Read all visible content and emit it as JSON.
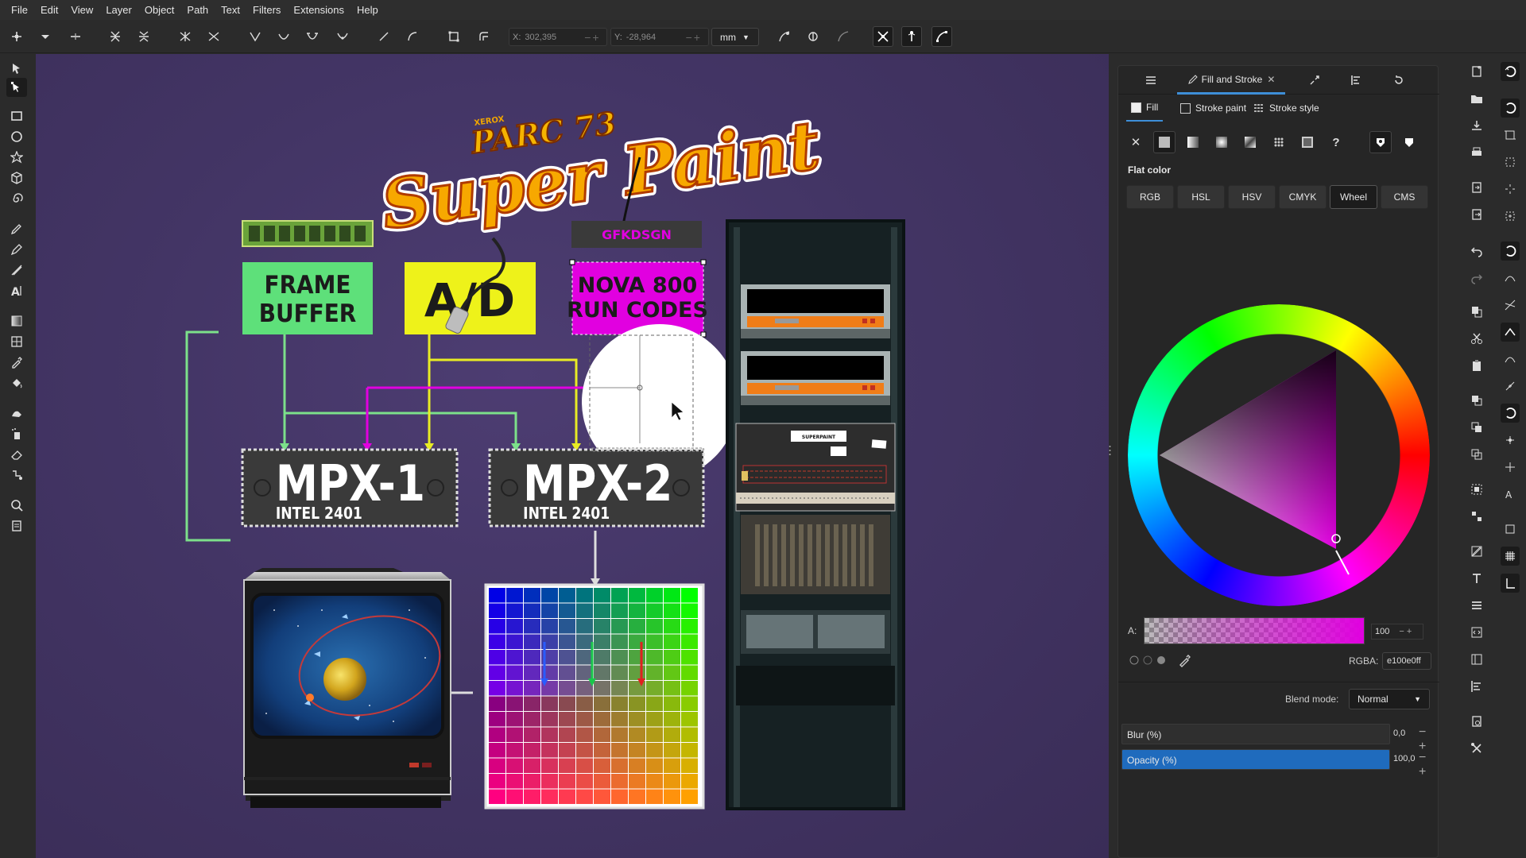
{
  "menu": [
    "File",
    "Edit",
    "View",
    "Layer",
    "Object",
    "Path",
    "Text",
    "Filters",
    "Extensions",
    "Help"
  ],
  "toolbar": {
    "x_label": "X:",
    "x_value": "302,395",
    "y_label": "Y:",
    "y_value": "-28,964",
    "unit": "mm"
  },
  "dock": {
    "tab_active_label": "Fill and Stroke",
    "fill_tab": "Fill",
    "stroke_paint_tab": "Stroke paint",
    "stroke_style_tab": "Stroke style",
    "flat_color_label": "Flat color",
    "modes": [
      "RGB",
      "HSL",
      "HSV",
      "CMYK",
      "Wheel",
      "CMS"
    ],
    "active_mode": "Wheel",
    "alpha_label": "A:",
    "alpha_value": "100",
    "rgba_label": "RGBA:",
    "rgba_value": "e100e0ff",
    "blend_label": "Blend mode:",
    "blend_value": "Normal",
    "blur_label": "Blur (%)",
    "blur_value": "0,0",
    "opacity_label": "Opacity (%)",
    "opacity_value": "100,0",
    "opacity_fraction": 1.0,
    "blur_fraction": 0.0
  },
  "artwork": {
    "title_small": "PARC 73",
    "title_tiny": "XEROX",
    "title_main": "Super Paint",
    "tag": "GFKDSGN",
    "frame_buffer": [
      "FRAME",
      "BUFFER"
    ],
    "ad": "A/D",
    "nova": [
      "NOVA 800",
      "RUN CODES"
    ],
    "mpx1": "MPX-1",
    "mpx1_sub": "INTEL 2401",
    "mpx2": "MPX-2",
    "mpx2_sub": "INTEL 2401",
    "rack_label_1": "SUPERPAINT",
    "rack_label_2": "XEROX"
  },
  "colors": {
    "accent": "#3d8ed8",
    "selected_fill": "#e100e0",
    "frame_buffer_green": "#5ee07a",
    "ad_yellow": "#eef21a",
    "nova_magenta": "#e100e0"
  }
}
